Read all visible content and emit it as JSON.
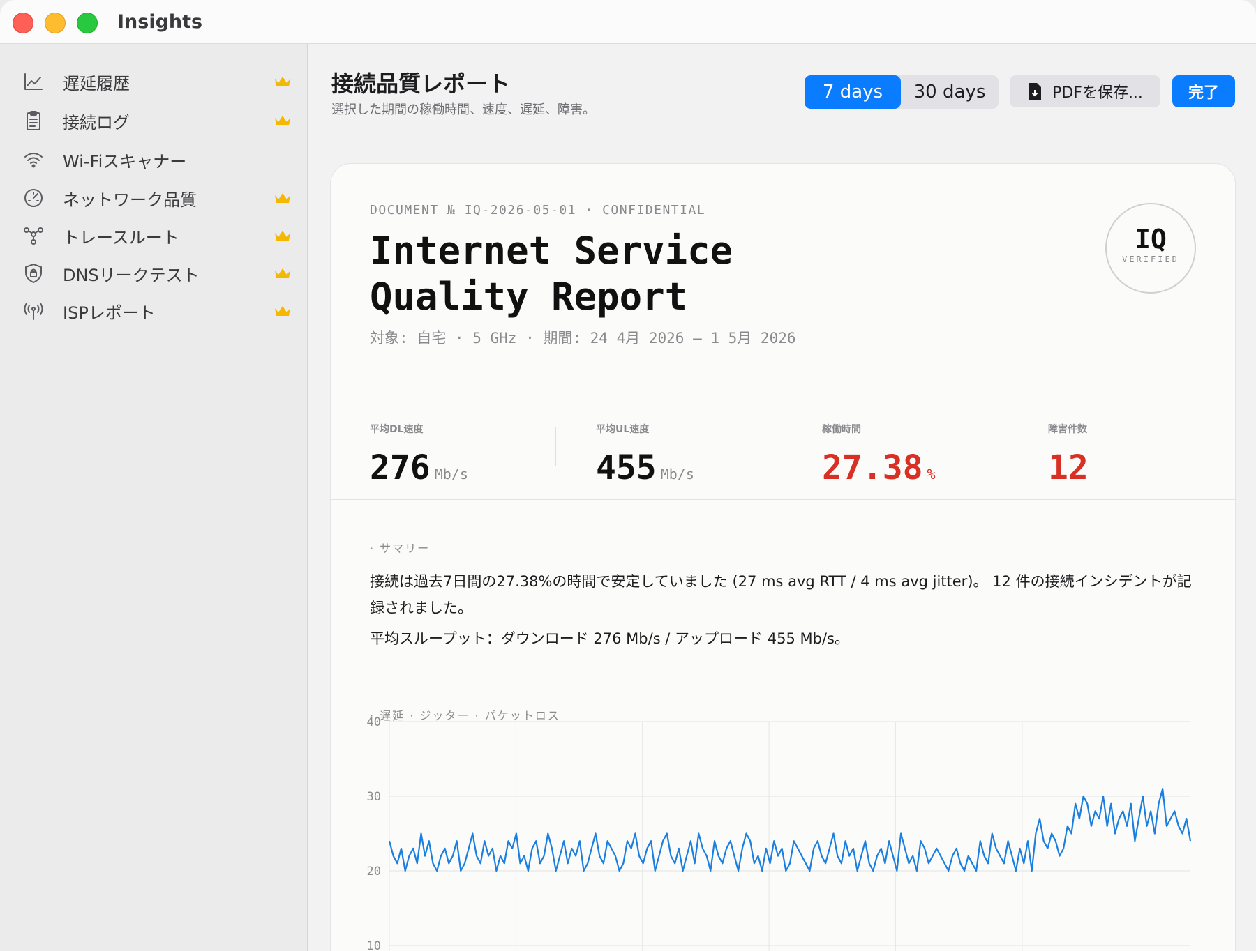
{
  "window": {
    "app_title": "Insights"
  },
  "sidebar": {
    "items": [
      {
        "label": "遅延履歴",
        "icon": "line-chart-icon",
        "premium": true
      },
      {
        "label": "接続ログ",
        "icon": "clipboard-icon",
        "premium": true
      },
      {
        "label": "Wi-Fiスキャナー",
        "icon": "wifi-icon",
        "premium": false
      },
      {
        "label": "ネットワーク品質",
        "icon": "gauge-icon",
        "premium": true
      },
      {
        "label": "トレースルート",
        "icon": "route-nodes-icon",
        "premium": true
      },
      {
        "label": "DNSリークテスト",
        "icon": "shield-lock-icon",
        "premium": true
      },
      {
        "label": "ISPレポート",
        "icon": "antenna-icon",
        "premium": true
      }
    ]
  },
  "header": {
    "title": "接続品質レポート",
    "subtitle": "選択した期間の稼働時間、速度、遅延、障害。",
    "range_options": [
      "7 days",
      "30 days"
    ],
    "selected_range": "7 days",
    "pdf_label": "PDFを保存...",
    "done_label": "完了"
  },
  "report": {
    "document_line": "DOCUMENT № IQ-2026-05-01 · CONFIDENTIAL",
    "title_line1": "Internet Service",
    "title_line2": "Quality Report",
    "meta": "対象: 自宅 · 5 GHz  ·  期間: 24 4月 2026 — 1 5月 2026",
    "seal_main": "IQ",
    "seal_sub": "VERIFIED",
    "stats": [
      {
        "label": "平均DL速度",
        "value": "276",
        "unit": "Mb/s",
        "alert": false
      },
      {
        "label": "平均UL速度",
        "value": "455",
        "unit": "Mb/s",
        "alert": false
      },
      {
        "label": "稼働時間",
        "value": "27.38",
        "unit": "%",
        "alert": true
      },
      {
        "label": "障害件数",
        "value": "12",
        "unit": "",
        "alert": true
      }
    ],
    "summary_label": "· サマリー",
    "summary_line1": "接続は過去7日間の27.38%の時間で安定していました (27 ms avg RTT / 4 ms avg jitter)。 12 件の接続インシデントが記録されました。",
    "summary_line2": "平均スループット：ダウンロード 276 Mb/s / アップロード 455 Mb/s。",
    "chart_label": "· 遅延  · ジッター  · パケットロス"
  },
  "colors": {
    "accent": "#0a7cff",
    "alert": "#d93025",
    "crown": "#f5b800",
    "series_latency": "#1a7fdf"
  },
  "chart_data": {
    "type": "line",
    "ylim": [
      0,
      40
    ],
    "yticks": [
      10,
      20,
      30,
      40
    ],
    "xlim": [
      0,
      199
    ],
    "series": [
      {
        "values": [
          24,
          22,
          21,
          23,
          20,
          22,
          23,
          21,
          25,
          22,
          24,
          21,
          20,
          22,
          23,
          21,
          22,
          24,
          20,
          21,
          23,
          25,
          22,
          21,
          24,
          22,
          23,
          20,
          22,
          21,
          24,
          23,
          25,
          21,
          22,
          20,
          23,
          24,
          21,
          22,
          25,
          23,
          20,
          22,
          24,
          21,
          23,
          22,
          24,
          20,
          21,
          23,
          25,
          22,
          21,
          24,
          23,
          22,
          20,
          21,
          24,
          23,
          25,
          22,
          21,
          23,
          24,
          20,
          22,
          24,
          25,
          22,
          21,
          23,
          20,
          22,
          24,
          21,
          25,
          23,
          22,
          20,
          24,
          22,
          21,
          23,
          24,
          22,
          20,
          23,
          25,
          24,
          21,
          22,
          20,
          23,
          21,
          24,
          22,
          23,
          20,
          21,
          24,
          23,
          22,
          21,
          20,
          23,
          24,
          22,
          21,
          23,
          25,
          22,
          21,
          24,
          22,
          23,
          20,
          22,
          24,
          21,
          20,
          22,
          23,
          21,
          24,
          22,
          20,
          25,
          23,
          21,
          22,
          20,
          24,
          23,
          21,
          22,
          23,
          22,
          21,
          20,
          22,
          23,
          21,
          20,
          22,
          21,
          20,
          24,
          22,
          21,
          25,
          23,
          22,
          21,
          24,
          22,
          20,
          23,
          21,
          24,
          20,
          25,
          27,
          24,
          23,
          25,
          24,
          22,
          23,
          26,
          25,
          29,
          27,
          30,
          29,
          26,
          28,
          27,
          30,
          26,
          29,
          25,
          27,
          28,
          26,
          29,
          24,
          27,
          30,
          26,
          28,
          25,
          29,
          31,
          26,
          27,
          28,
          26,
          25,
          27,
          24
        ]
      }
    ]
  }
}
